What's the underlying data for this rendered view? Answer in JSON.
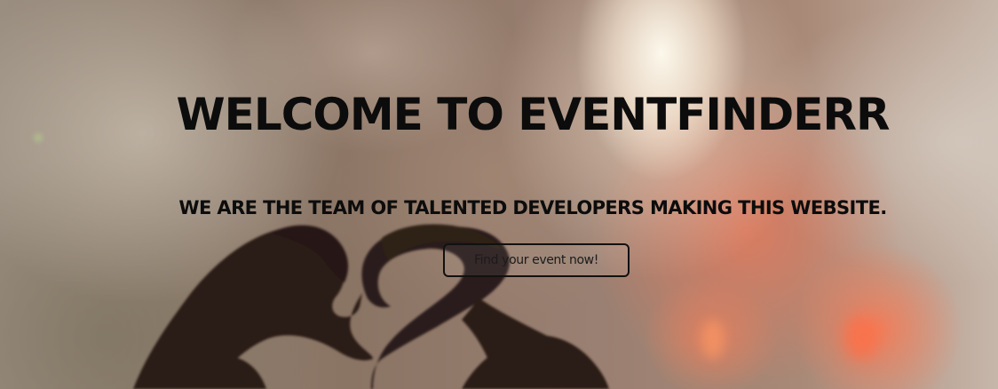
{
  "hero": {
    "title": "WELCOME TO EVENTFINDERR",
    "subtitle": "WE ARE THE TEAM OF TALENTED DEVELOPERS MAKING THIS WEBSITE.",
    "cta_label": "Find your event now!",
    "background_image": "heart-hands-concert-photo",
    "colors": {
      "text": "#0c0c0c",
      "button_border": "#111111",
      "stage_light": "#fff8ee",
      "warm_light": "#e8785a"
    }
  }
}
